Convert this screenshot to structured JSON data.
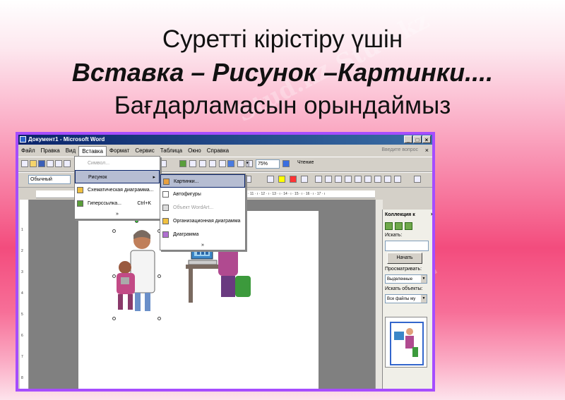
{
  "slide": {
    "line1": "Суретті кірістіру үшін",
    "line2": "Вставка – Рисунок –Картинки....",
    "line3": "Бағдарламасын орындаймыз",
    "watermark": "Stud.kz"
  },
  "window": {
    "title": "Документ1 - Microsoft Word",
    "help_placeholder": "Введите вопрос"
  },
  "menubar": [
    "Файл",
    "Правка",
    "Вид",
    "Вставка",
    "Формат",
    "Сервис",
    "Таблица",
    "Окно",
    "Справка"
  ],
  "toolbar": {
    "zoom": "75%",
    "reading": "Чтение",
    "style": "Обычный"
  },
  "insert_menu": {
    "symbol": "Символ...",
    "picture": "Рисунок",
    "diagram": "Схематическая диаграмма...",
    "hyperlink": "Гиперссылка...",
    "hyperlink_shortcut": "Ctrl+K",
    "more": "»"
  },
  "picture_menu": {
    "clipart": "Картинки...",
    "autoshapes": "Автофигуры",
    "wordart": "Объект WordArt...",
    "orgchart": "Организационная диаграмма",
    "chart": "Диаграмма",
    "more": "»"
  },
  "ruler_text": "· 11 · ı · 12 · ı · 13 · ı · 14 · ı · 15 · ı · 16 · ı · 17 · ı",
  "vruler_numbers": [
    "1",
    "2",
    "3",
    "4",
    "5",
    "6",
    "7",
    "8"
  ],
  "task_pane": {
    "title": "Коллекция к",
    "search_label": "Искать:",
    "start_button": "Начать",
    "browse_label": "Просматривать:",
    "browse_value": "Выделенные",
    "objects_label": "Искать объекты:",
    "objects_value": "Все файлы му"
  },
  "colors": {
    "frame": "#a64dff",
    "titlebar": "#0a246a"
  }
}
